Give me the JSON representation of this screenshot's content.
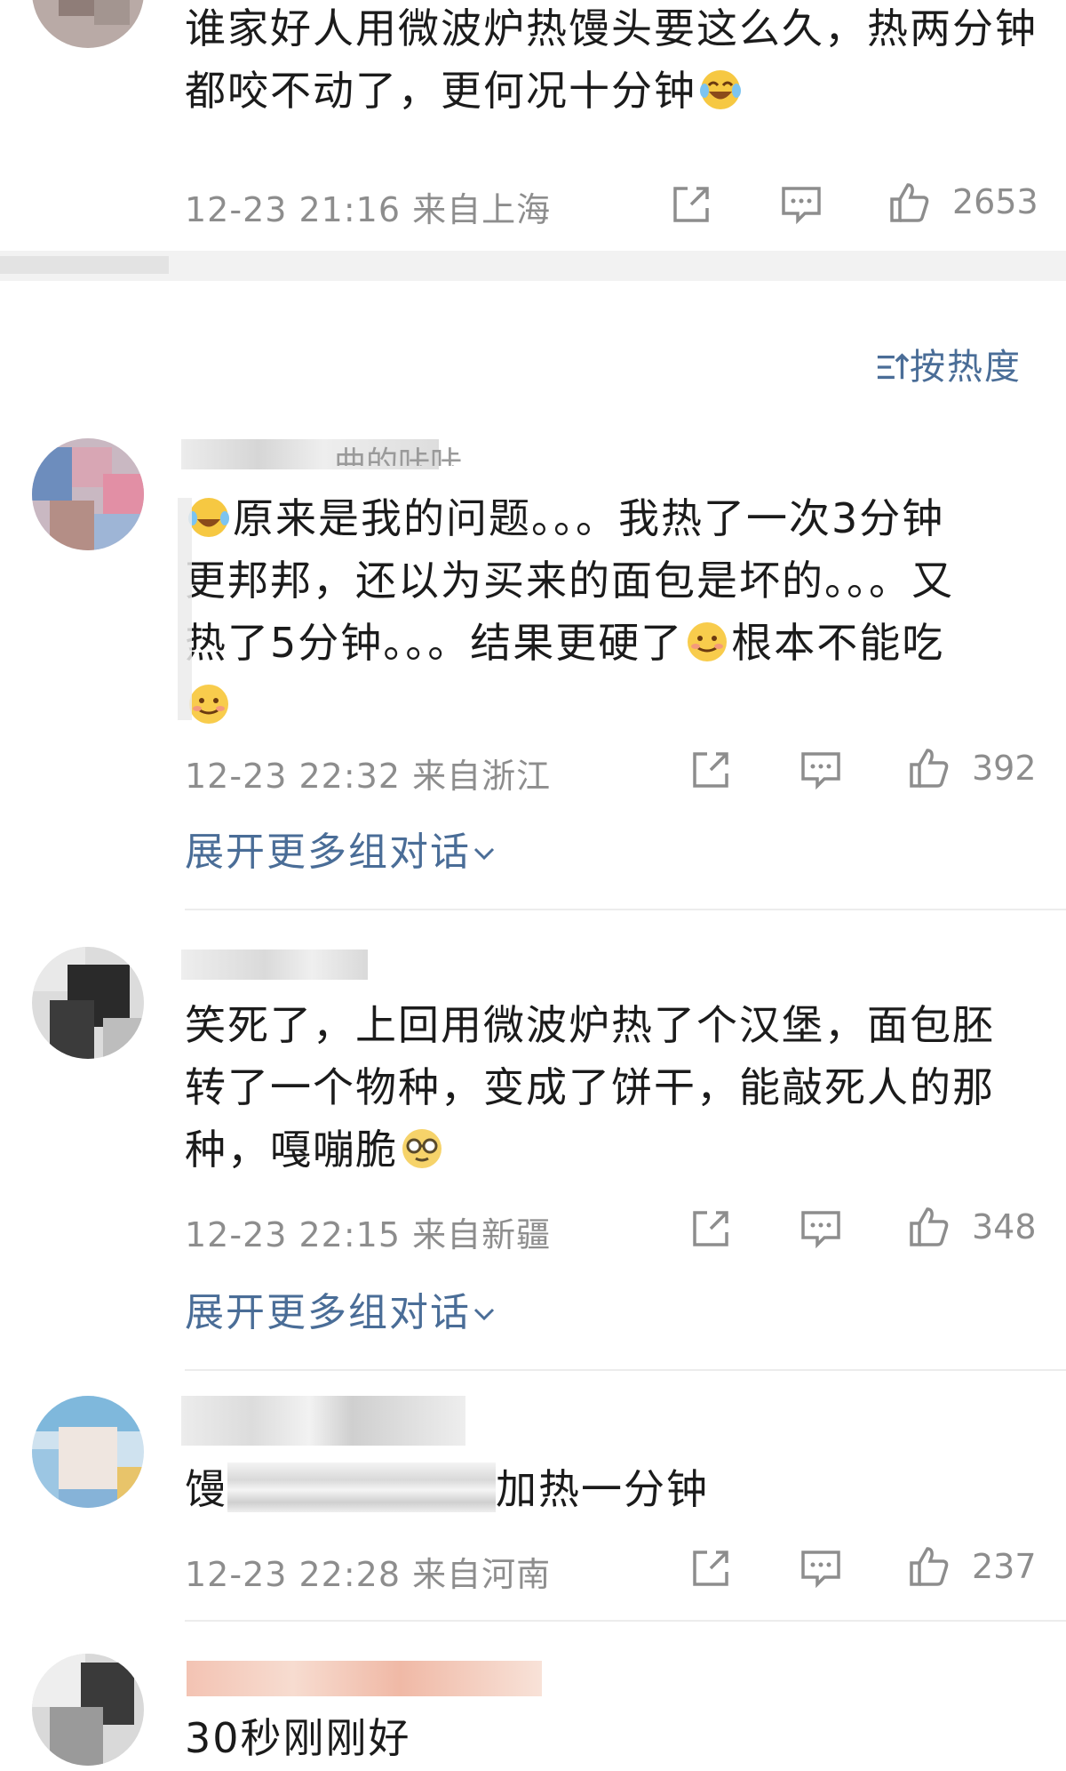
{
  "comments": [
    {
      "text_parts": [
        "谁家好人用微波炉热馒头要这么久，热两分钟都咬不动了，更何况十分钟",
        ""
      ],
      "time": "12-23 21:16",
      "location": "来自上海",
      "likes": "2653"
    },
    {
      "name_suffix": "曲的咔咔",
      "text_parts": [
        "原来是我的问题。。。我热了一次3分钟",
        "更邦邦，还以为买来的面包是坏的。。。又",
        "热了5分钟。。。结果更硬了",
        "根本不能吃",
        ""
      ],
      "time": "12-23 22:32",
      "location": "来自浙江",
      "likes": "392",
      "expand": "展开更多组对话"
    },
    {
      "text_parts": [
        "笑死了，上回用微波炉热了个汉堡，面包胚",
        "转了一个物种，变成了饼干，能敲死人的那",
        "种，嘎嘣脆"
      ],
      "time": "12-23 22:15",
      "location": "来自新疆",
      "likes": "348",
      "expand": "展开更多组对话"
    },
    {
      "text_parts": [
        "馒",
        "加热一分钟"
      ],
      "time": "12-23 22:28",
      "location": "来自河南",
      "likes": "237"
    },
    {
      "text_parts": [
        "30秒刚刚好"
      ]
    }
  ],
  "sort": {
    "label": "按热度",
    "icon": "sort-icon"
  },
  "colors": {
    "link": "#4a6d97",
    "meta": "#8d8d8d",
    "text": "#1b1b1b"
  }
}
